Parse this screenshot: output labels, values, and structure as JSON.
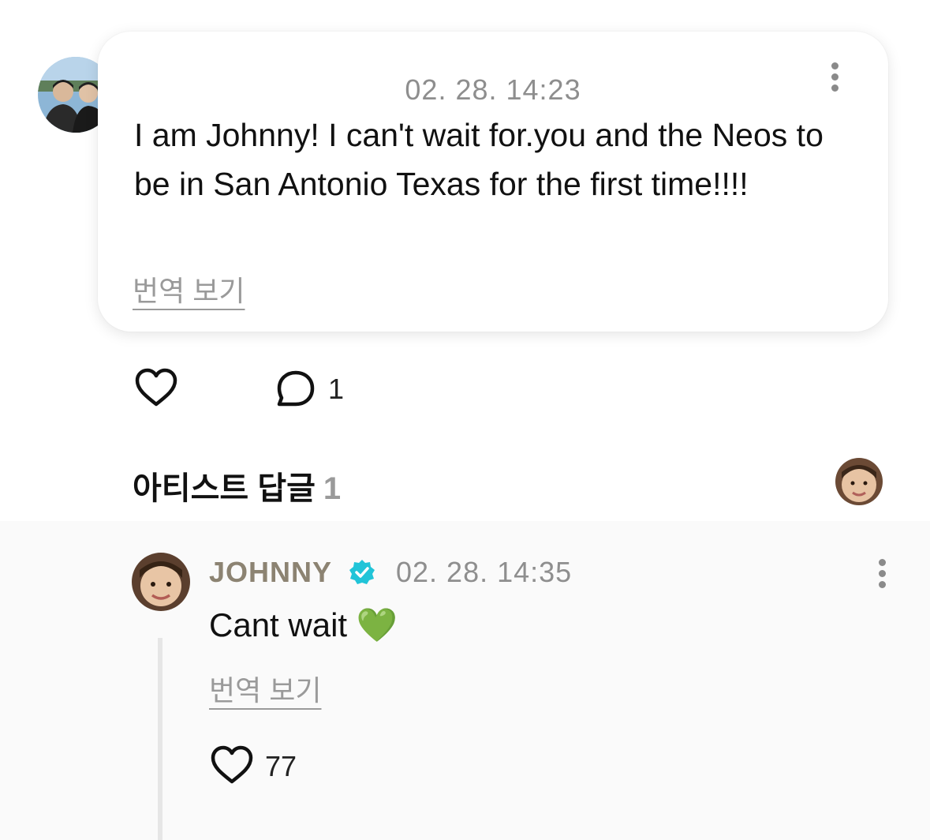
{
  "post": {
    "timestamp": "02. 28. 14:23",
    "text": "I am Johnny! I can't wait for.you and the Neos to be in San Antonio Texas for the first time!!!!",
    "translate_label": "번역 보기",
    "comment_count": "1",
    "menu_icon": "more-vertical-icon",
    "like_icon": "heart-outline-icon",
    "comment_icon": "speech-bubble-icon"
  },
  "artist_replies": {
    "title": "아티스트 답글",
    "count": "1"
  },
  "reply": {
    "author": "JOHNNY",
    "verified_icon": "verified-badge-icon",
    "timestamp": "02. 28. 14:35",
    "text": "Cant wait 💚",
    "translate_label": "번역 보기",
    "like_count": "77"
  },
  "colors": {
    "verified": "#21c4d8",
    "author": "#8c8372",
    "muted": "#8e8e8e",
    "reply_background": "#fafafa"
  }
}
